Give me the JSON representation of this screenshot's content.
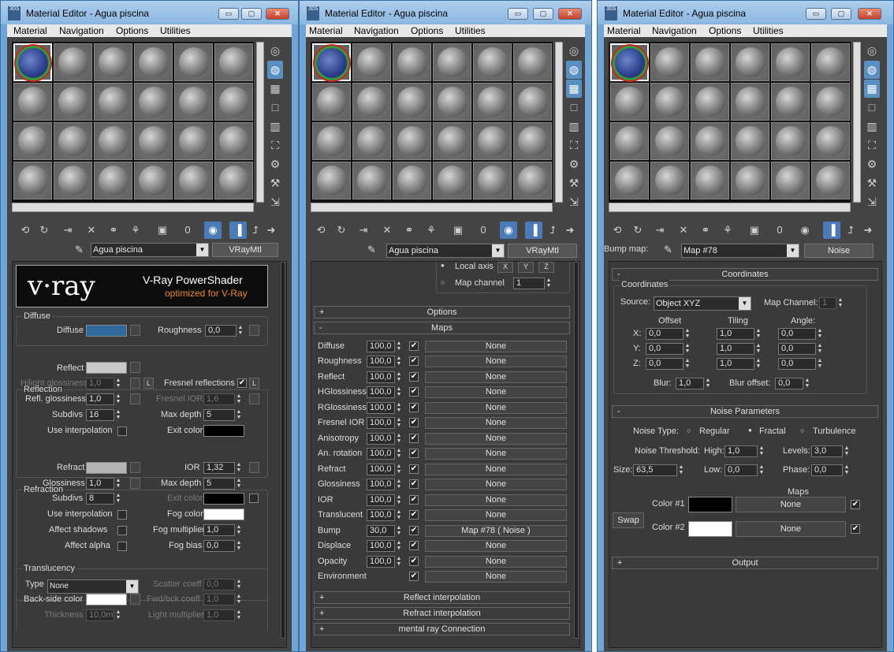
{
  "window_title": "Material Editor - Agua piscina",
  "app_logo": "3DS",
  "menu": [
    "Material",
    "Navigation",
    "Options",
    "Utilities"
  ],
  "title_buttons": {
    "minimize": "▭",
    "maximize": "▢",
    "close": "✕"
  },
  "material_name": "Agua piscina",
  "material_type": "VRayMtl",
  "w3_label": "Bump map:",
  "map_name": "Map #78",
  "map_type": "Noise",
  "reset_field": "0",
  "vray_logo": {
    "brand": "v·ray",
    "line1": "V-Ray PowerShader",
    "line2": "optimized for V-Ray"
  },
  "diffuse": {
    "group": "Diffuse",
    "diffuse": "Diffuse",
    "roughness": "Roughness",
    "roughness_val": "0,0",
    "diffuse_color": "#2e6a9c"
  },
  "reflection": {
    "group": "Reflection",
    "reflect": "Reflect",
    "reflect_color": "#c8c8c8",
    "hilight_gloss": "Hilight glossiness",
    "hilight_gloss_val": "1,0",
    "l": "L",
    "fresnel": "Fresnel reflections",
    "refl_gloss": "Refl. glossiness",
    "refl_gloss_val": "1,0",
    "fresnel_ior": "Fresnel IOR",
    "fresnel_ior_val": "1,6",
    "subdivs": "Subdivs",
    "subdivs_val": "16",
    "max_depth": "Max depth",
    "max_depth_val": "5",
    "use_interp": "Use interpolation",
    "exit_color": "Exit color"
  },
  "refraction": {
    "group": "Refraction",
    "refract": "Refract",
    "refract_color": "#b4b4b4",
    "ior": "IOR",
    "ior_val": "1,32",
    "glossiness": "Glossiness",
    "glossiness_val": "1,0",
    "max_depth": "Max depth",
    "max_depth_val": "5",
    "subdivs": "Subdivs",
    "subdivs_val": "8",
    "exit_color": "Exit color",
    "use_interp": "Use interpolation",
    "fog_color": "Fog color",
    "affect_shadows": "Affect shadows",
    "fog_mult": "Fog multiplier",
    "fog_mult_val": "1,0",
    "affect_alpha": "Affect alpha",
    "fog_bias": "Fog bias",
    "fog_bias_val": "0,0"
  },
  "translucency": {
    "group": "Translucency",
    "type": "Type",
    "type_val": "None",
    "scatter": "Scatter coeff",
    "scatter_val": "0,0",
    "backside": "Back-side color",
    "fwd_bck": "Fwd/bck coeff",
    "fwd_bck_val": "1,0",
    "thickness": "Thickness",
    "thickness_val": "10,0m",
    "light_mult": "Light multiplier",
    "light_mult_val": "1,0"
  },
  "w2_top": {
    "local_axis": "Local axis",
    "map_channel": "Map channel",
    "map_channel_val": "1",
    "xyz": [
      "X",
      "Y",
      "Z"
    ]
  },
  "w2_rollouts": {
    "options": "Options",
    "maps": "Maps",
    "reflect_interp": "Reflect interpolation",
    "refract_interp": "Refract interpolation",
    "mental_ray": "mental ray Connection"
  },
  "maps": [
    {
      "name": "Diffuse",
      "amount": "100,0",
      "map": "None"
    },
    {
      "name": "Roughness",
      "amount": "100,0",
      "map": "None"
    },
    {
      "name": "Reflect",
      "amount": "100,0",
      "map": "None"
    },
    {
      "name": "HGlossiness",
      "amount": "100,0",
      "map": "None"
    },
    {
      "name": "RGlossiness",
      "amount": "100,0",
      "map": "None"
    },
    {
      "name": "Fresnel IOR",
      "amount": "100,0",
      "map": "None"
    },
    {
      "name": "Anisotropy",
      "amount": "100,0",
      "map": "None"
    },
    {
      "name": "An. rotation",
      "amount": "100,0",
      "map": "None"
    },
    {
      "name": "Refract",
      "amount": "100,0",
      "map": "None"
    },
    {
      "name": "Glossiness",
      "amount": "100,0",
      "map": "None"
    },
    {
      "name": "IOR",
      "amount": "100,0",
      "map": "None"
    },
    {
      "name": "Translucent",
      "amount": "100,0",
      "map": "None"
    },
    {
      "name": "Bump",
      "amount": "30,0",
      "map": "Map #78  ( Noise )"
    },
    {
      "name": "Displace",
      "amount": "100,0",
      "map": "None"
    },
    {
      "name": "Opacity",
      "amount": "100,0",
      "map": "None"
    },
    {
      "name": "Environment",
      "amount": "",
      "map": "None"
    }
  ],
  "coords": {
    "rollout": "Coordinates",
    "group": "Coordinates",
    "source": "Source:",
    "source_val": "Object XYZ",
    "map_channel": "Map Channel:",
    "map_channel_val": "1",
    "offset": "Offset",
    "tiling": "Tiling",
    "angle": "Angle:",
    "rows": [
      {
        "axis": "X:",
        "offset": "0,0",
        "tiling": "1,0",
        "angle": "0,0"
      },
      {
        "axis": "Y:",
        "offset": "0,0",
        "tiling": "1,0",
        "angle": "0,0"
      },
      {
        "axis": "Z:",
        "offset": "0,0",
        "tiling": "1,0",
        "angle": "0,0"
      }
    ],
    "blur": "Blur:",
    "blur_val": "1,0",
    "blur_offset": "Blur offset:",
    "blur_offset_val": "0,0"
  },
  "noise": {
    "rollout": "Noise Parameters",
    "noise_type": "Noise Type:",
    "regular": "Regular",
    "fractal": "Fractal",
    "turbulence": "Turbulence",
    "threshold": "Noise Threshold:",
    "high": "High:",
    "high_val": "1,0",
    "levels": "Levels:",
    "levels_val": "3,0",
    "size": "Size:",
    "size_val": "63,5",
    "low": "Low:",
    "low_val": "0,0",
    "phase": "Phase:",
    "phase_val": "0,0",
    "maps": "Maps",
    "color1": "Color #1",
    "color2": "Color #2",
    "swap": "Swap",
    "none": "None"
  },
  "output": "Output",
  "rollout_plus": "+",
  "rollout_minus": "-",
  "check_mark": "✔",
  "icons": {
    "get_material": "⟲",
    "put_to_scene": "↻",
    "assign": "⇥",
    "reset": "✕",
    "copy": "⚭",
    "unique": "⚘",
    "library": "▣",
    "effects": "◉",
    "show_map": "▥",
    "show_end": "▐",
    "go_parent": "⮥",
    "go_forward": "➜",
    "sample_type": "◎",
    "backlight": "◍",
    "background": "▦",
    "tiling": "□",
    "video_check": "▥",
    "preview": "⛶",
    "options": "⚙",
    "select_by": "⚒",
    "nav": "⇲",
    "picker": "✎",
    "arrow_left": "◀",
    "arrow_right": "▶",
    "arrow_up": "▲",
    "arrow_down": "▼",
    "combo_arrow": "▼"
  }
}
